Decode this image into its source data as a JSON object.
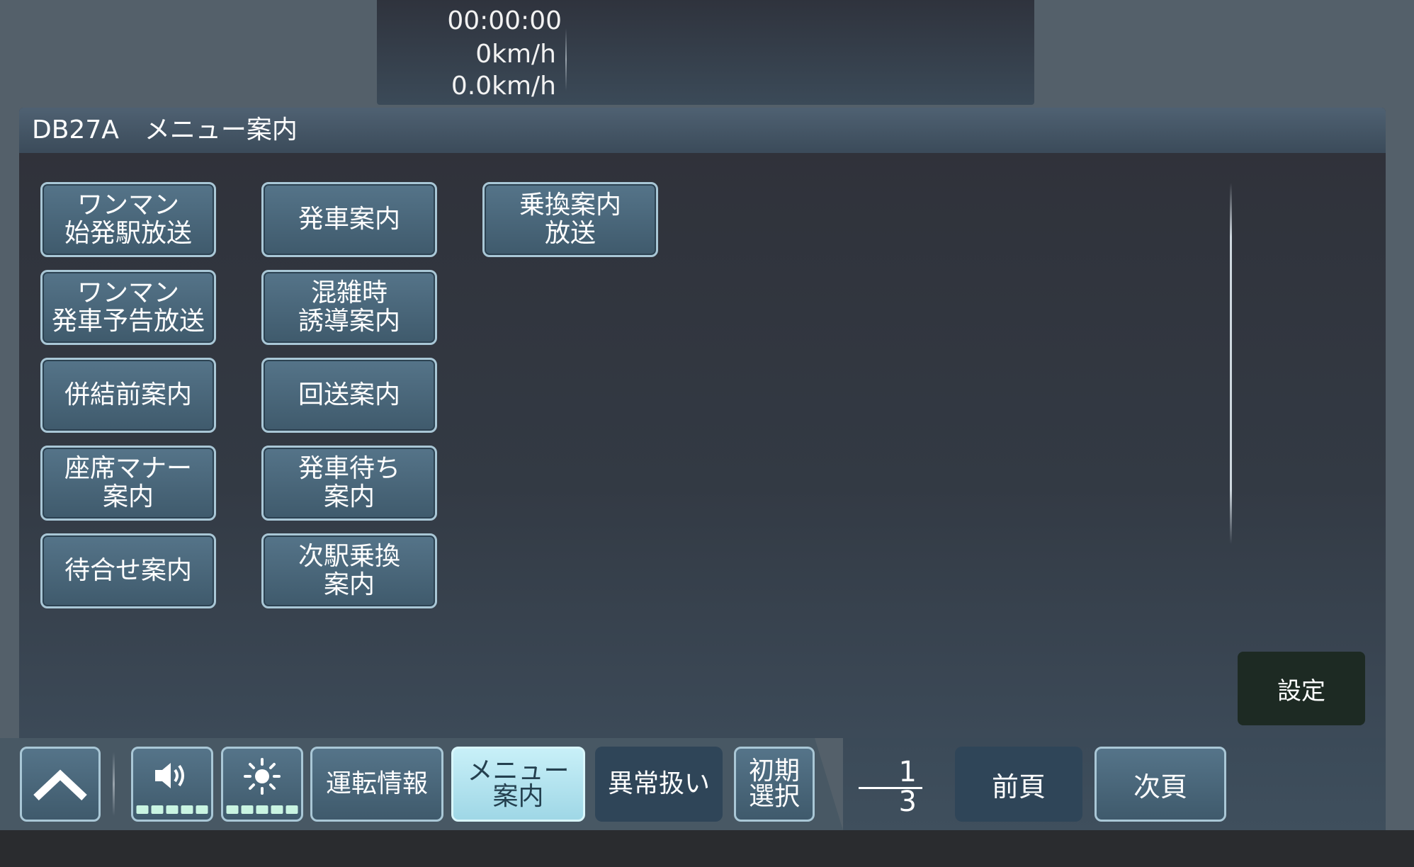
{
  "status": {
    "time": "00:00:00",
    "speed1": "0km/h",
    "speed2": "0.0km/h"
  },
  "panel": {
    "title": "DB27A　メニュー案内"
  },
  "menu": {
    "b1": "ワンマン\n始発駅放送",
    "b2": "ワンマン\n発車予告放送",
    "b3": "併結前案内",
    "b4": "座席マナー\n案内",
    "b5": "待合せ案内",
    "b6": "発車案内",
    "b7": "混雑時\n誘導案内",
    "b8": "回送案内",
    "b9": "発車待ち\n案内",
    "b10": "次駅乗換\n案内",
    "b11": "乗換案内\n放送"
  },
  "settings_label": "設定",
  "toolbar": {
    "unyu": "運転情報",
    "menu": "メニュー\n案内",
    "ijou": "異常扱い",
    "shoki": "初期\n選択"
  },
  "page": {
    "current": "1",
    "total": "3"
  },
  "nav": {
    "prev": "前頁",
    "next": "次頁"
  },
  "icons": {
    "up": "chevron-up-icon",
    "volume": "speaker-icon",
    "brightness": "sun-icon"
  },
  "colors": {
    "button_face": "#4a687c",
    "button_border": "#a9c7d6",
    "active_button": "#b4e6f1",
    "settings_button": "#1d2a23"
  }
}
